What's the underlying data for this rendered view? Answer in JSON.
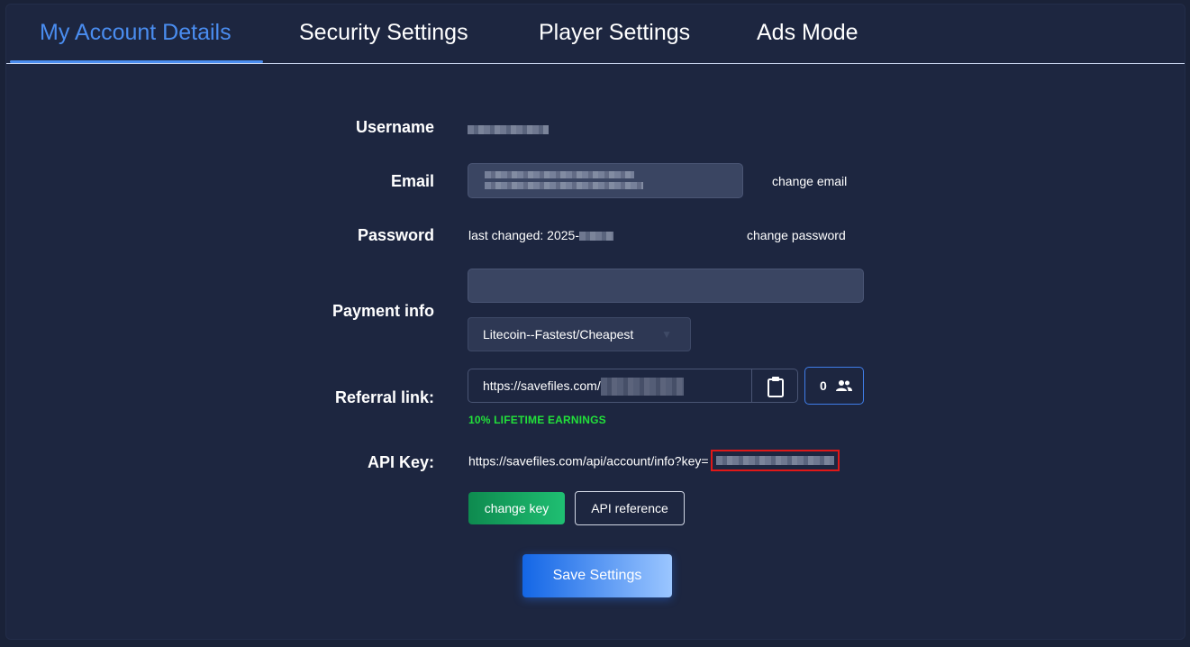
{
  "tabs": [
    {
      "label": "My Account Details",
      "active": true
    },
    {
      "label": "Security Settings",
      "active": false
    },
    {
      "label": "Player Settings",
      "active": false
    },
    {
      "label": "Ads Mode",
      "active": false
    }
  ],
  "fields": {
    "username_label": "Username",
    "email_label": "Email",
    "change_email": "change email",
    "password_label": "Password",
    "password_changed": "last changed: 2025-",
    "change_password": "change password",
    "payment_label": "Payment info",
    "payment_value": "",
    "payment_method": "Litecoin--Fastest/Cheapest",
    "referral_label": "Referral link:",
    "referral_url": "https://savefiles.com/",
    "referral_count": "0",
    "lifetime_earnings": "10% LIFETIME EARNINGS",
    "api_label": "API Key:",
    "api_url": "https://savefiles.com/api/account/info?key="
  },
  "buttons": {
    "change_key": "change key",
    "api_reference": "API reference",
    "save": "Save Settings"
  },
  "colors": {
    "background": "#1d2640",
    "accent": "#4a8df0",
    "success": "#22e03a",
    "highlight": "#e01818"
  },
  "icons": {
    "clipboard": "clipboard-icon",
    "users": "users-icon",
    "dropdown": "chevron-down-icon"
  }
}
